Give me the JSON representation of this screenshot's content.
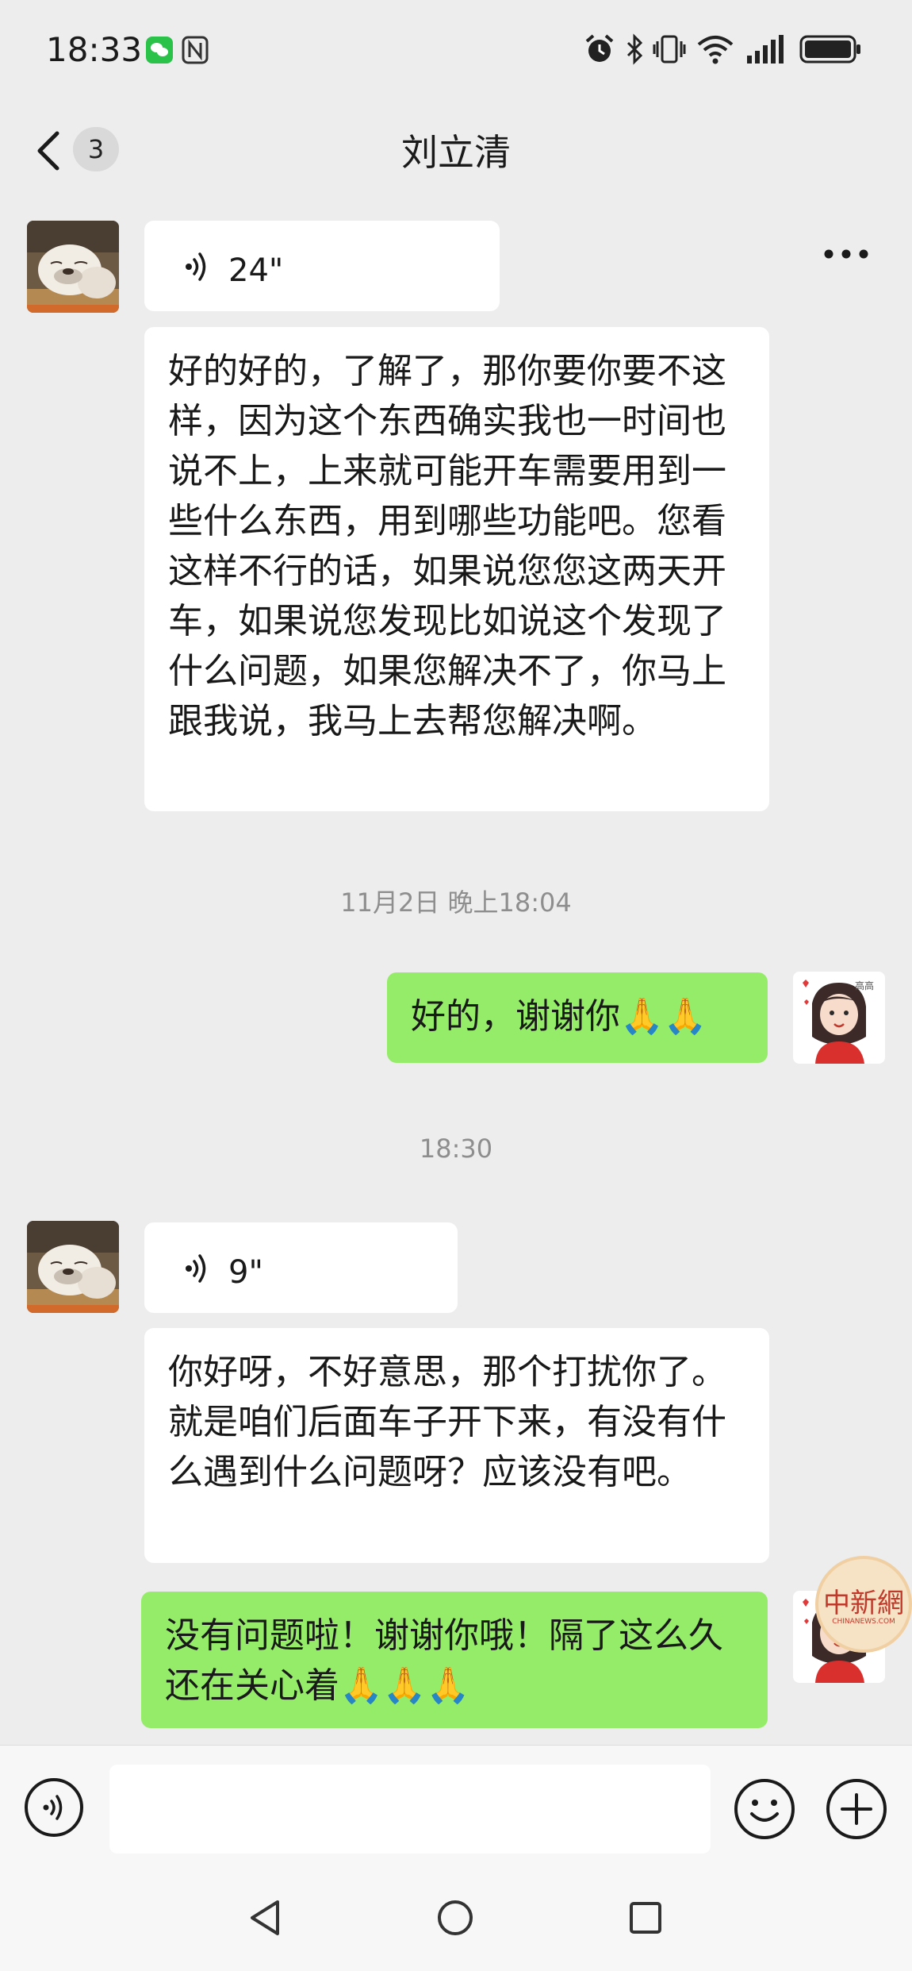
{
  "status_bar": {
    "time": "18:33",
    "icons": [
      "wechat-notification-icon",
      "nfc-icon",
      "alarm-icon",
      "bluetooth-icon",
      "vibrate-icon",
      "wifi-icon",
      "signal-icon",
      "battery-icon"
    ]
  },
  "header": {
    "title": "刘立清",
    "unread_count": "3",
    "back_icon": "chevron-left-icon",
    "more_icon": "more-dots-icon"
  },
  "messages": [
    {
      "direction": "incoming",
      "type": "voice",
      "duration": "24\""
    },
    {
      "direction": "incoming",
      "type": "text",
      "text": "好的好的，了解了，那你要你要不这样，因为这个东西确实我也一时间也说不上，上来就可能开车需要用到一些什么东西，用到哪些功能吧。您看这样不行的话，如果说您您这两天开车，如果说您发现比如说这个发现了什么问题，如果您解决不了，你马上跟我说，我马上去帮您解决啊。"
    },
    {
      "type": "timestamp",
      "text": "11月2日 晚上18:04"
    },
    {
      "direction": "outgoing",
      "type": "text",
      "text": "好的，谢谢你🙏🙏"
    },
    {
      "type": "timestamp",
      "text": "18:30"
    },
    {
      "direction": "incoming",
      "type": "voice",
      "duration": "9\""
    },
    {
      "direction": "incoming",
      "type": "text",
      "text": "你好呀，不好意思，那个打扰你了。就是咱们后面车子开下来，有没有什么遇到什么问题呀？应该没有吧。"
    },
    {
      "direction": "outgoing",
      "type": "text",
      "text": "没有问题啦！谢谢你哦！隔了这么久还在关心着🙏🙏🙏"
    }
  ],
  "watermark": {
    "chinese": "中新網",
    "english": "CHINANEWS.COM"
  },
  "input_bar": {
    "voice_icon": "voice-input-icon",
    "emoji_icon": "emoji-icon",
    "plus_icon": "plus-icon",
    "placeholder": ""
  },
  "nav_bar": {
    "icons": [
      "nav-back-icon",
      "nav-home-icon",
      "nav-recents-icon"
    ]
  },
  "colors": {
    "background": "#ededed",
    "outgoing_bubble": "#95ec69",
    "incoming_bubble": "#ffffff",
    "timestamp_text": "#8e8e8e"
  }
}
